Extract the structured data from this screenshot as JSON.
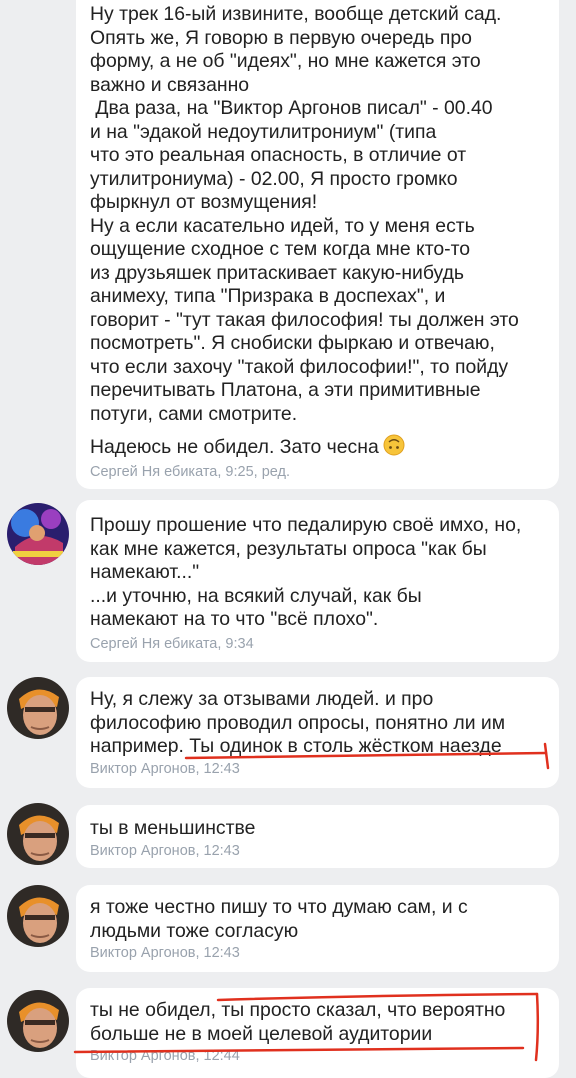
{
  "messages": [
    {
      "text": "Ну трек 16-ый извините, вообще детский сад.\nОпять же, Я говорю в первую очередь про\nформу, а не об \"идеях\", но мне кажется это\nважно и связанно\n Два раза, на \"Виктор Аргонов писал\" - 00.40\nи на \"эдакой недоутилитрониум\" (типа\nчто это реальная опасность, в отличие от\nутилитрониума) - 02.00, Я просто громко\nфыркнул от возмущения!\nНу а если касательно идей, то у меня есть\nощущение сходное с тем когда мне кто-то\nиз друзьяшек притаскивает какую-нибудь\nанимеху, типа \"Призрака в доспехах\", и\nговорит - \"тут такая философия! ты должен это\nпосмотреть\". Я снобиски фыркаю и отвечаю,\nчто если захочу \"такой философии!\", то пойду\nперечитывать Платона, а эти примитивные\nпотуги, сами смотрите.",
      "tail": "Надеюсь не обидел. Зато чесна",
      "tail_emoji": "upside-down-face-emoji",
      "meta": "Сергей Ня ебиката, 9:25, ред."
    },
    {
      "text": "Прошу прошение что педалирую своё имхо, но,\nкак мне кажется, результаты опроса \"как бы\nнамекают...\"\n...и уточню, на всякий случай, как бы\nнамекают на то что \"всё плохо\".",
      "meta": "Сергей Ня ебиката, 9:34",
      "avatar": "avatar-sergey"
    },
    {
      "text": "Ну, я слежу за отзывами людей. и про\nфилософию проводил опросы, понятно ли им\nнапример. Ты одинок в столь жёстком наезде",
      "meta": "Виктор Аргонов, 12:43",
      "avatar": "avatar-viktor"
    },
    {
      "text": "ты в меньшинстве",
      "meta": "Виктор Аргонов, 12:43",
      "avatar": "avatar-viktor"
    },
    {
      "text": "я тоже честно пишу то что думаю сам, и с\nлюдьми тоже согласую",
      "meta": "Виктор Аргонов, 12:43",
      "avatar": "avatar-viktor"
    },
    {
      "text": "ты не обидел, ты просто сказал, что вероятно\nбольше не в моей целевой аудитории",
      "meta": "Виктор Аргонов, 12:44",
      "avatar": "avatar-viktor"
    }
  ],
  "colors": {
    "background": "#edeef0",
    "bubble": "#ffffff",
    "text": "#222222",
    "meta": "#99a2ad",
    "annotation": "#e0301e"
  }
}
